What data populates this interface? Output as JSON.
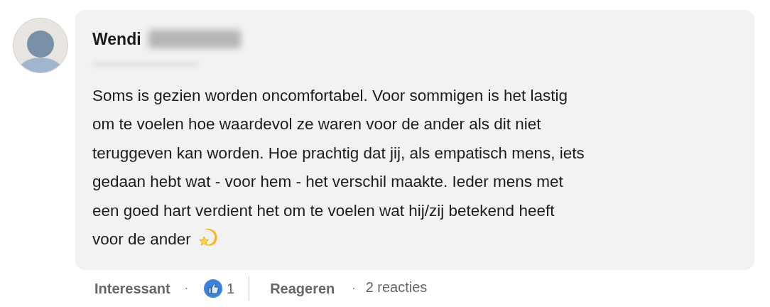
{
  "comment": {
    "author_first_name": "Wendi",
    "body_lines": [
      "Soms is gezien worden oncomfortabel. Voor sommigen is het lastig",
      "om te voelen hoe waardevol ze waren voor de ander als dit niet",
      "teruggeven kan worden. Hoe prachtig dat jij, als empatisch mens, iets",
      "gedaan hebt wat - voor hem - het verschil maakte. Ieder mens met",
      "een goed hart verdient het om te voelen wat hij/zij betekend heeft",
      "voor de ander"
    ]
  },
  "actions": {
    "react_label": "Interessant",
    "separator_1": "·",
    "reaction_count": "1",
    "reply_label": "Reageren",
    "separator_2": "·",
    "replies_count": "2 reacties"
  }
}
